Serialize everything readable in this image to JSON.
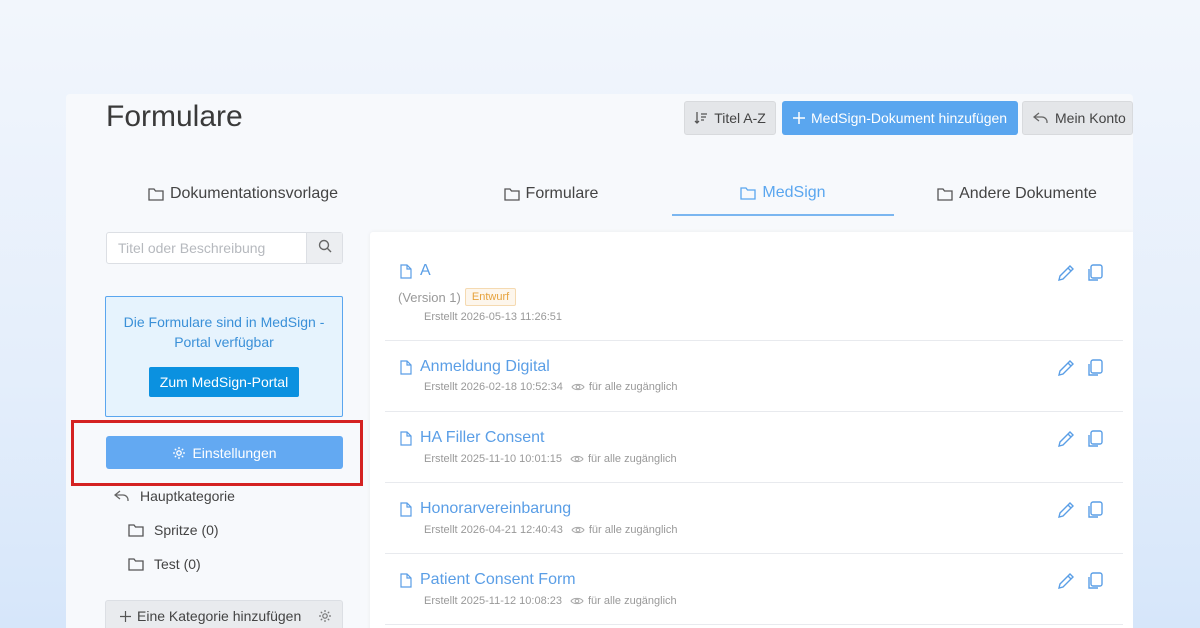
{
  "header": {
    "title": "Formulare",
    "sort_label": "Titel A-Z",
    "add_label": "MedSign-Dokument hinzufügen",
    "account_label": "Mein Konto"
  },
  "tabs": [
    {
      "label": "Dokumentationsvorlage",
      "active": false
    },
    {
      "label": "Formulare",
      "active": false
    },
    {
      "label": "MedSign",
      "active": true
    },
    {
      "label": "Andere Dokumente",
      "active": false
    }
  ],
  "sidebar": {
    "search_placeholder": "Titel oder Beschreibung",
    "info_text": "Die Formulare sind in MedSign - Portal verfügbar",
    "portal_button": "Zum MedSign-Portal",
    "settings_button": "Einstellungen",
    "main_category": "Hauptkategorie",
    "categories": [
      {
        "label": "Spritze (0)"
      },
      {
        "label": "Test (0)"
      }
    ],
    "add_category": "Eine Kategorie hinzufügen"
  },
  "documents": [
    {
      "title": "A",
      "version": "(Version 1)",
      "badge": "Entwurf",
      "created": "Erstellt 2026-05-13 11:26:51",
      "visibility": ""
    },
    {
      "title": "Anmeldung Digital",
      "version": "",
      "badge": "",
      "created": "Erstellt 2026-02-18 10:52:34",
      "visibility": "für alle zugänglich"
    },
    {
      "title": "HA Filler Consent",
      "version": "",
      "badge": "",
      "created": "Erstellt 2025-11-10 10:01:15",
      "visibility": "für alle zugänglich"
    },
    {
      "title": "Honorarvereinbarung",
      "version": "",
      "badge": "",
      "created": "Erstellt 2026-04-21 12:40:43",
      "visibility": "für alle zugänglich"
    },
    {
      "title": "Patient Consent Form",
      "version": "",
      "badge": "",
      "created": "Erstellt 2025-11-12 10:08:23",
      "visibility": "für alle zugänglich"
    }
  ],
  "colors": {
    "accent": "#5aa6ef",
    "portal_button": "#0b91e0",
    "highlight_border": "#d42222",
    "badge_text": "#e6a23c"
  },
  "icons": {
    "sort": "sort-icon",
    "add": "plus-icon",
    "account": "reply-arrow-icon",
    "tab": "folder-icon",
    "search": "search-icon",
    "settings": "gear-icon",
    "document": "document-icon",
    "edit": "pencil-icon",
    "copy": "copy-icon",
    "visibility": "eye-icon"
  }
}
